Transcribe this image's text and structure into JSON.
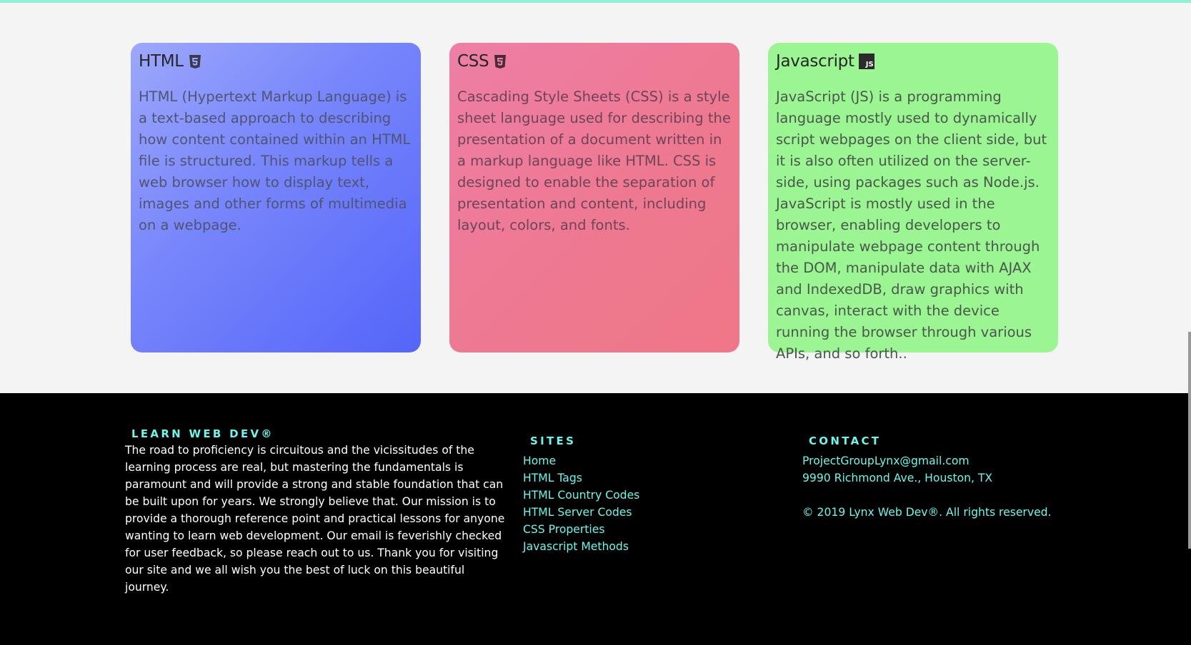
{
  "cards": [
    {
      "title": "HTML",
      "icon": "html5-icon",
      "body": "HTML (Hypertext Markup Language) is a text-based approach to describing how content contained within an HTML file is structured. This markup tells a web browser how to display text, images and other forms of multimedia on a webpage."
    },
    {
      "title": "CSS",
      "icon": "css3-icon",
      "body": "Cascading Style Sheets (CSS) is a style sheet language used for describing the presentation of a document written in a markup language like HTML. CSS is designed to enable the separation of presentation and content, including layout, colors, and fonts."
    },
    {
      "title": "Javascript",
      "icon": "js-icon",
      "icon_text": "JS",
      "body": "JavaScript (JS) is a programming language mostly used to dynamically script webpages on the client side, but it is also often utilized on the server-side, using packages such as Node.js. JavaScript is mostly used in the browser, enabling developers to manipulate webpage content through the DOM, manipulate data with AJAX and IndexedDB, draw graphics with canvas, interact with the device running the browser through various APIs, and so forth.."
    }
  ],
  "footer": {
    "about": {
      "heading": "LEARN WEB DEV®",
      "text": "The road to proficiency is circuitous and the vicissitudes of the learning process are real, but mastering the fundamentals is paramount and will provide a strong and stable foundation that can be built upon for years. We strongly believe that. Our mission is to provide a thorough reference point and practical lessons for anyone wanting to learn web development. Our email is feverishly checked for user feedback, so please reach out to us. Thank you for visiting our site and we all wish you the best of luck on this beautiful journey."
    },
    "sites": {
      "heading": "SITES",
      "links": [
        "Home",
        "HTML Tags",
        "HTML Country Codes",
        "HTML Server Codes",
        "CSS Properties",
        "Javascript Methods"
      ]
    },
    "contact": {
      "heading": "CONTACT",
      "email": "ProjectGroupLynx@gmail.com",
      "address": "9990 Richmond Ave., Houston, TX",
      "copyright": "© 2019 Lynx Web Dev®. All rights reserved."
    }
  },
  "colors": {
    "accent": "#6ef5ea",
    "top_bar": "#8ef0d3",
    "html_card": "#6a79fa",
    "css_card": "#ef7a95",
    "js_card": "#9af592"
  }
}
